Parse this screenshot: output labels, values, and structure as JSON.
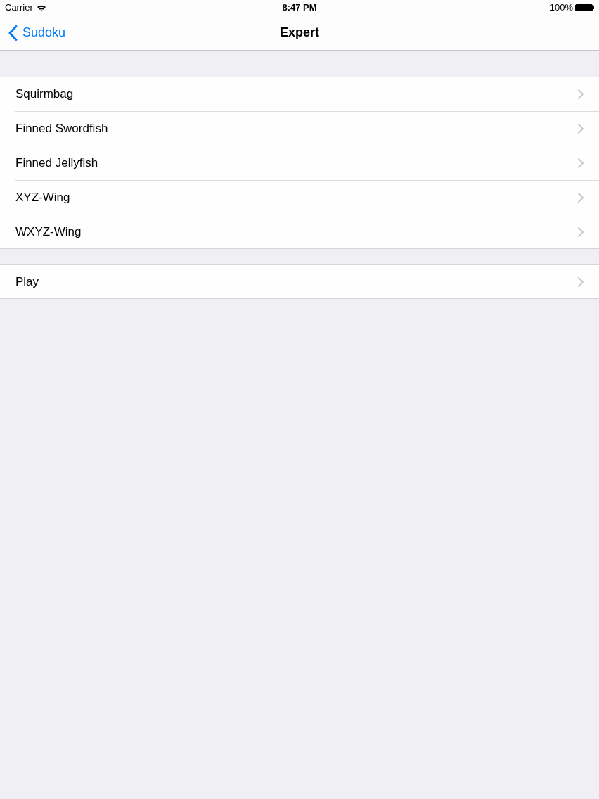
{
  "status_bar": {
    "carrier": "Carrier",
    "time": "8:47 PM",
    "battery": "100%"
  },
  "nav_bar": {
    "back_label": "Sudoku",
    "title": "Expert"
  },
  "sections": [
    {
      "rows": [
        {
          "label": "Squirmbag"
        },
        {
          "label": "Finned Swordfish"
        },
        {
          "label": "Finned Jellyfish"
        },
        {
          "label": "XYZ-Wing"
        },
        {
          "label": "WXYZ-Wing"
        }
      ]
    },
    {
      "rows": [
        {
          "label": "Play"
        }
      ]
    }
  ]
}
